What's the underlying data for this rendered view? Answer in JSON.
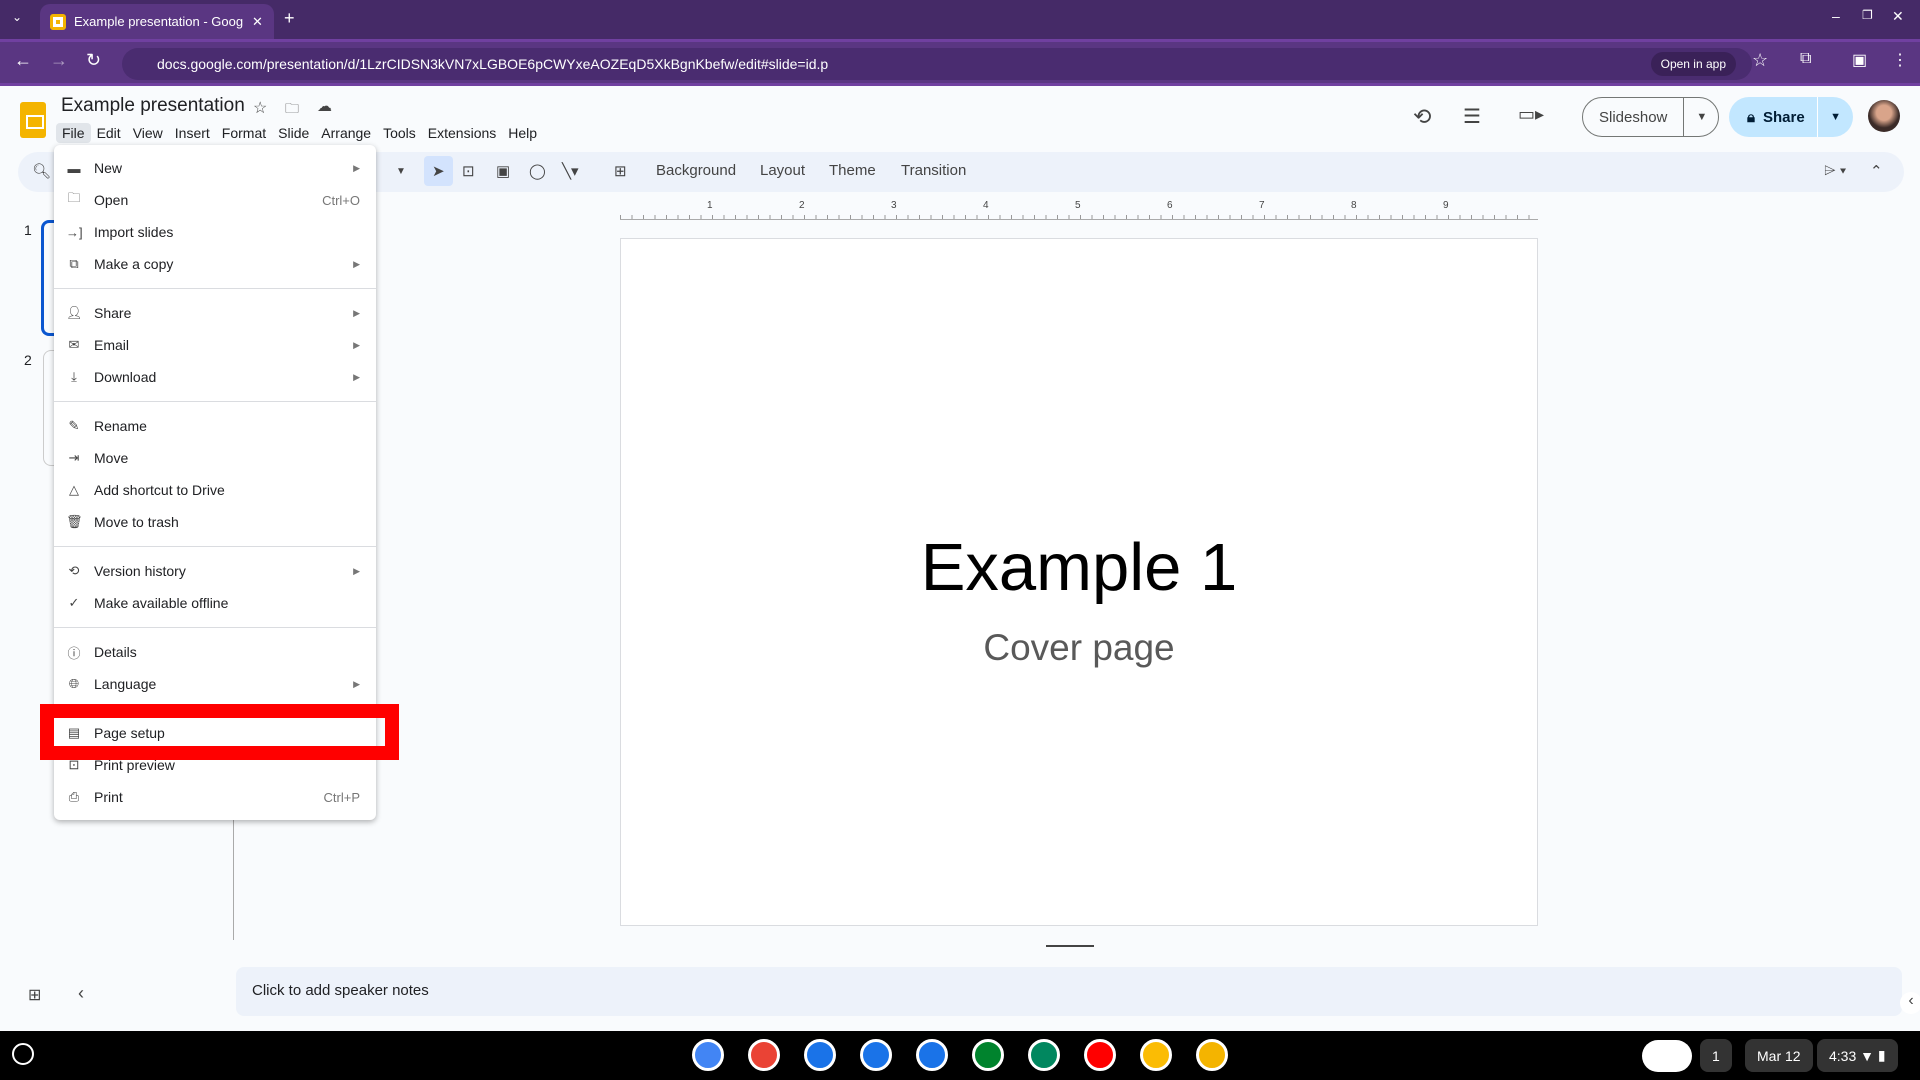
{
  "browser": {
    "tab_title": "Example presentation - Google",
    "url": "docs.google.com/presentation/d/1LzrCIDSN3kVN7xLGBOE6pCWYxeAOZEqD5XkBgnKbefw/edit#slide=id.p",
    "open_in_app": "Open in app"
  },
  "app": {
    "title": "Example presentation",
    "menus": [
      "File",
      "Edit",
      "View",
      "Insert",
      "Format",
      "Slide",
      "Arrange",
      "Tools",
      "Extensions",
      "Help"
    ],
    "slideshow": "Slideshow",
    "share": "Share",
    "toolbar": [
      "Background",
      "Layout",
      "Theme",
      "Transition"
    ]
  },
  "ruler": [
    "1",
    "2",
    "3",
    "4",
    "5",
    "6",
    "7",
    "8",
    "9"
  ],
  "thumbnails": [
    "1",
    "2"
  ],
  "slide": {
    "title": "Example 1",
    "subtitle": "Cover page"
  },
  "file_menu": {
    "groups": [
      [
        {
          "label": "New",
          "icon": "new-icon",
          "submenu": true
        },
        {
          "label": "Open",
          "icon": "folder-icon",
          "shortcut": "Ctrl+O"
        },
        {
          "label": "Import slides",
          "icon": "import-icon"
        },
        {
          "label": "Make a copy",
          "icon": "copy-icon",
          "submenu": true
        }
      ],
      [
        {
          "label": "Share",
          "icon": "person-add-icon",
          "submenu": true
        },
        {
          "label": "Email",
          "icon": "email-icon",
          "submenu": true
        },
        {
          "label": "Download",
          "icon": "download-icon",
          "submenu": true
        }
      ],
      [
        {
          "label": "Rename",
          "icon": "rename-icon"
        },
        {
          "label": "Move",
          "icon": "move-folder-icon"
        },
        {
          "label": "Add shortcut to Drive",
          "icon": "drive-shortcut-icon"
        },
        {
          "label": "Move to trash",
          "icon": "trash-icon"
        }
      ],
      [
        {
          "label": "Version history",
          "icon": "history-icon",
          "submenu": true
        },
        {
          "label": "Make available offline",
          "icon": "offline-icon"
        }
      ],
      [
        {
          "label": "Details",
          "icon": "info-icon"
        },
        {
          "label": "Language",
          "icon": "globe-icon",
          "submenu": true
        }
      ],
      [
        {
          "label": "Page setup",
          "icon": "page-icon",
          "highlighted": true
        },
        {
          "label": "Print preview",
          "icon": "print-preview-icon"
        },
        {
          "label": "Print",
          "icon": "print-icon",
          "shortcut": "Ctrl+P"
        }
      ]
    ]
  },
  "notes": {
    "placeholder": "Click to add speaker notes"
  },
  "taskbar": {
    "date": "Mar 12",
    "time": "4:33",
    "notifications": "1",
    "apps": [
      {
        "name": "chrome",
        "color": "#4285f4"
      },
      {
        "name": "gmail",
        "color": "#ea4335"
      },
      {
        "name": "calendar",
        "color": "#1a73e8"
      },
      {
        "name": "files",
        "color": "#1a73e8"
      },
      {
        "name": "messages",
        "color": "#1a73e8"
      },
      {
        "name": "meet",
        "color": "#00832d"
      },
      {
        "name": "play-store",
        "color": "#01875f"
      },
      {
        "name": "youtube",
        "color": "#ff0000"
      },
      {
        "name": "photos",
        "color": "#fbbc04"
      },
      {
        "name": "slides",
        "color": "#f4b400"
      }
    ]
  },
  "colors": {
    "accent": "#0b57d0",
    "highlight": "#ff0000",
    "browser": "#5a3682"
  }
}
